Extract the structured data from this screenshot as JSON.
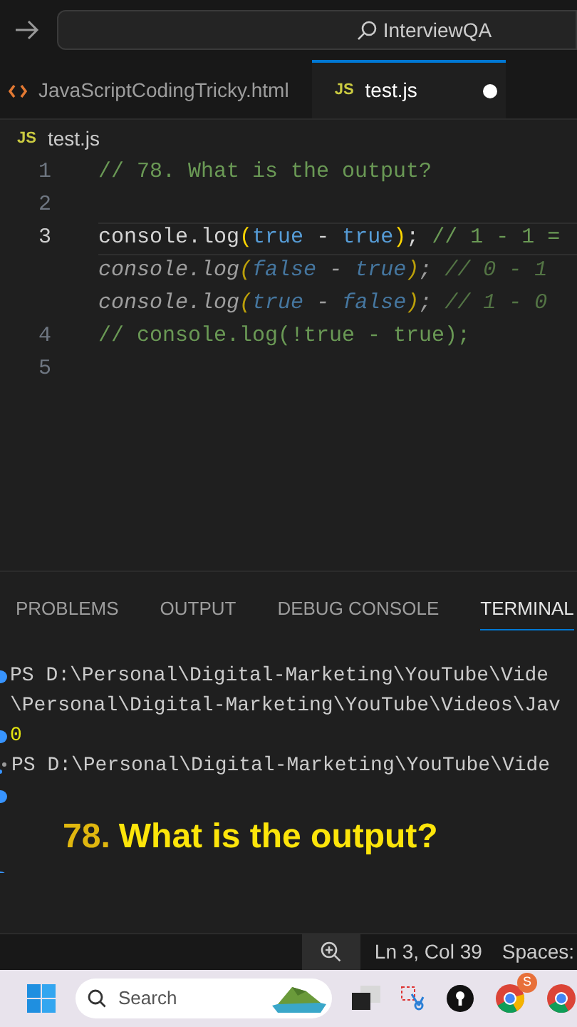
{
  "title_bar": {
    "search": "InterviewQA"
  },
  "tabs": [
    {
      "kind": "html",
      "label": "JavaScriptCodingTricky.html",
      "selected": false,
      "modified": false
    },
    {
      "kind": "script",
      "badge": "JS",
      "label": "test.js",
      "selected": true,
      "modified": true
    }
  ],
  "breadcrumb": {
    "icon": "JS",
    "label": "test.js"
  },
  "editor": {
    "lines": [
      {
        "number": "1",
        "current": false,
        "ghost": false,
        "tokens": [
          {
            "text": "// 78. What is the output?",
            "kind": "comment"
          }
        ]
      },
      {
        "number": "2",
        "current": false,
        "ghost": false
      },
      {
        "number": "3",
        "current": true,
        "ghost": false,
        "tokens": [
          {
            "text": "console.log",
            "kind": "plain"
          },
          {
            "text": "(",
            "kind": "paren"
          },
          {
            "text": "true",
            "kind": "bool"
          },
          {
            "text": " - ",
            "kind": "plain"
          },
          {
            "text": "true",
            "kind": "bool"
          },
          {
            "text": ")",
            "kind": "paren"
          },
          {
            "text": "; ",
            "kind": "plain"
          },
          {
            "text": "// 1 - 1 =",
            "kind": "comment"
          }
        ]
      },
      {
        "current": false,
        "ghost": true,
        "tokens": [
          {
            "text": "console.log",
            "kind": "plain"
          },
          {
            "text": "(",
            "kind": "paren"
          },
          {
            "text": "false",
            "kind": "bool"
          },
          {
            "text": " - ",
            "kind": "plain"
          },
          {
            "text": "true",
            "kind": "bool"
          },
          {
            "text": ")",
            "kind": "paren"
          },
          {
            "text": "; ",
            "kind": "plain"
          },
          {
            "text": "// 0 - 1",
            "kind": "comment"
          }
        ]
      },
      {
        "current": false,
        "ghost": true,
        "tokens": [
          {
            "text": "console.log",
            "kind": "plain"
          },
          {
            "text": "(",
            "kind": "paren"
          },
          {
            "text": "true",
            "kind": "bool"
          },
          {
            "text": " - ",
            "kind": "plain"
          },
          {
            "text": "false",
            "kind": "bool"
          },
          {
            "text": ")",
            "kind": "paren"
          },
          {
            "text": "; ",
            "kind": "plain"
          },
          {
            "text": "// 1 - 0",
            "kind": "comment"
          }
        ]
      },
      {
        "number": "4",
        "current": false,
        "ghost": false,
        "tokens": [
          {
            "text": "// console.log(!true - true);",
            "kind": "comment"
          }
        ]
      },
      {
        "number": "5",
        "current": false,
        "ghost": false
      }
    ]
  },
  "panel": {
    "tabs": [
      {
        "label": "PROBLEMS",
        "selected": false
      },
      {
        "label": "OUTPUT",
        "selected": false
      },
      {
        "label": "DEBUG CONSOLE",
        "selected": false
      },
      {
        "label": "TERMINAL",
        "selected": true
      }
    ],
    "terminal": [
      {
        "kind": "line",
        "dot": true,
        "sparkle": false,
        "text": "PS D:\\Personal\\Digital-Marketing\\YouTube\\Vide"
      },
      {
        "kind": "line",
        "dot": false,
        "sparkle": false,
        "text": "\\Personal\\Digital-Marketing\\YouTube\\Videos\\Jav"
      },
      {
        "kind": "output",
        "dot": true,
        "sparkle": false,
        "text": "0"
      },
      {
        "kind": "line",
        "dot": false,
        "sparkle": true,
        "text": "PS D:\\Personal\\Digital-Marketing\\YouTube\\Vide"
      },
      {
        "kind": "line",
        "dot": true,
        "sparkle": false
      },
      {
        "kind": "caption",
        "number": "78.",
        "text": "What is the output?"
      },
      {
        "kind": "line",
        "dot": true,
        "sparkle": false
      }
    ]
  },
  "status_bar": {
    "position": "Ln 3, Col 39",
    "spaces": "Spaces:"
  },
  "taskbar": {
    "search": "Search",
    "badge": "S"
  }
}
